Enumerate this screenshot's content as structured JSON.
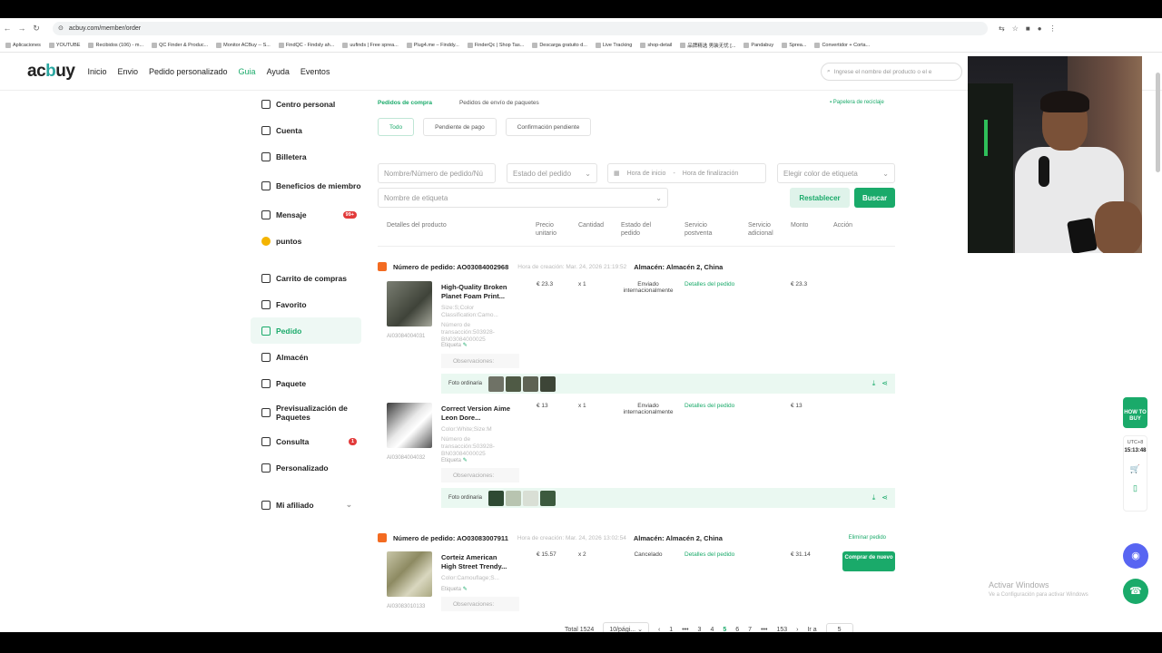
{
  "browser": {
    "url": "acbuy.com/member/order",
    "bookmarks": [
      "Aplicaciones",
      "YOUTUBE",
      "Recibidos (106) - m...",
      "QC Finder & Produc...",
      "Monitor ACBuy -- S...",
      "FindQC - Findsly ah...",
      "uufinds | Free sprea...",
      "Plug4.me – Finddy...",
      "FinderQc | Shop Tas...",
      "Descarga gratuito d...",
      "Live Tracking",
      "shop-detail",
      "品牌精选 男装无忧 [...",
      "Pandabuy",
      "Sprea...",
      "Convertidor + Corta..."
    ]
  },
  "header": {
    "logo": "acbuy",
    "nav": [
      "Inicio",
      "Envio",
      "Pedido personalizado",
      "Guia",
      "Ayuda",
      "Eventos"
    ],
    "search_placeholder": "Ingrese el nombre del producto o el e"
  },
  "sidebar": {
    "items": [
      {
        "label": "Centro personal"
      },
      {
        "label": "Cuenta"
      },
      {
        "label": "Billetera"
      },
      {
        "label": "Beneficios de miembro"
      },
      {
        "label": "Mensaje",
        "badge": "99+"
      },
      {
        "label": "puntos"
      },
      {
        "label": "Carrito de compras"
      },
      {
        "label": "Favorito"
      },
      {
        "label": "Pedido"
      },
      {
        "label": "Almacén"
      },
      {
        "label": "Paquete"
      },
      {
        "label": "Previsualización de Paquetes"
      },
      {
        "label": "Consulta",
        "badge": "1"
      },
      {
        "label": "Personalizado"
      },
      {
        "label": "Mi afiliado"
      }
    ]
  },
  "main": {
    "tabs": [
      "Pedidos de compra",
      "Pedidos de envío de paquetes"
    ],
    "papelera": "Papelera de reciclaje",
    "status_filters": [
      "Todo",
      "Pendiente de pago",
      "Confirmación pendiente"
    ],
    "inputs": {
      "order_no": "Nombre/Número de pedido/Nú",
      "estado": "Estado del pedido",
      "hora_inicio": "Hora de inicio",
      "hora_fin": "Hora de finalización",
      "color_etiqueta": "Elegir color de etiqueta",
      "nombre_etiqueta": "Nombre de etiqueta"
    },
    "reset_label": "Restablecer",
    "search_label": "Buscar",
    "columns": [
      "Detalles del producto",
      "Precio unitario",
      "Cantidad",
      "Estado del pedido",
      "Servicio postventa",
      "Servicio adicional",
      "Monto",
      "Acción"
    ],
    "orders": [
      {
        "number": "Número de pedido: AO03084002968",
        "time": "Hora de creación: Mar. 24, 2026 21:19:52",
        "warehouse": "Almacén: Almacén 2, China",
        "items": [
          {
            "name": "High-Quality Broken Planet Foam Print...",
            "attrs": "Size:S;Color Classification:Camo...",
            "txn": "Número de transacción:503928-BN03084000025",
            "id": "AI03084004031",
            "price": "€ 23.3",
            "qty": "x 1",
            "status": "Enviado internacionalmente",
            "details": "Detalles del pedido",
            "amount": "€ 23.3"
          },
          {
            "name": "Correct Version Aime Leon Dore...",
            "attrs": "Color:White;Size:M",
            "txn": "Número de transacción:503928-BN03084000025",
            "id": "AI03084004032",
            "price": "€ 13",
            "qty": "x 1",
            "status": "Enviado internacionalmente",
            "details": "Detalles del pedido",
            "amount": "€ 13"
          }
        ]
      },
      {
        "number": "Número de pedido: AO03083007911",
        "time": "Hora de creación: Mar. 24, 2026 13:02:54",
        "warehouse": "Almacén: Almacén 2, China",
        "delete": "Eliminar pedido",
        "items": [
          {
            "name": "Corteiz American High Street Trendy...",
            "attrs": "Color:Camouflage;S...",
            "id": "AI03083010133",
            "price": "€ 15.57",
            "qty": "x 2",
            "status": "Cancelado",
            "details": "Detalles del pedido",
            "amount": "€ 31.14",
            "buy_again": "Comprar de nuevo"
          }
        ]
      }
    ],
    "etiqueta": "Etiqueta",
    "observaciones": "Observaciones:",
    "foto": "Foto ordinaria",
    "pager": {
      "total": "Total 1524",
      "per_page": "10/pági...",
      "pages": [
        "1",
        "•••",
        "3",
        "4",
        "5",
        "6",
        "7",
        "•••",
        "153"
      ],
      "current": "5",
      "goto_label": "Ir a",
      "goto_value": "5"
    }
  },
  "widgets": {
    "howtobuy": "HOW TO BUY",
    "utc": "UTC+8",
    "clock": "15:13:48",
    "activate_title": "Activar Windows",
    "activate_sub": "Ve a Configuración para activar Windows"
  },
  "colors": {
    "accent": "#1aaa6a",
    "order_icon": "#f36b21",
    "badge": "#e23a3a"
  }
}
